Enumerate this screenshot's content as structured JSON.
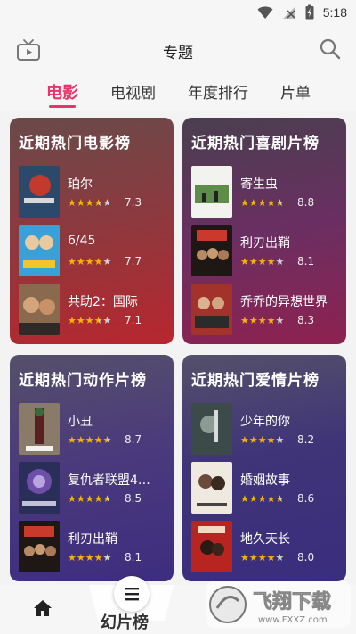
{
  "status_bar": {
    "time": "5:18",
    "icons": [
      "wifi-icon",
      "no-signal-icon",
      "battery-charging-icon"
    ]
  },
  "app_bar": {
    "title": "专题",
    "left_icon": "tv-icon",
    "right_icon": "search-icon"
  },
  "tabs": [
    {
      "label": "电影",
      "active": true
    },
    {
      "label": "电视剧",
      "active": false
    },
    {
      "label": "年度排行",
      "active": false
    },
    {
      "label": "片单",
      "active": false
    }
  ],
  "colors": {
    "accent": "#e8336b",
    "star": "#f5b301"
  },
  "cards": [
    {
      "title": "近期热门电影榜",
      "items": [
        {
          "name": "珀尔",
          "rating": 3.5,
          "score": "7.3"
        },
        {
          "name": "6/45",
          "rating": 4.0,
          "score": "7.7"
        },
        {
          "name": "共助2：国际",
          "rating": 3.5,
          "score": "7.1"
        }
      ]
    },
    {
      "title": "近期热门喜剧片榜",
      "items": [
        {
          "name": "寄生虫",
          "rating": 4.5,
          "score": "8.8"
        },
        {
          "name": "利刃出鞘",
          "rating": 4.0,
          "score": "8.1"
        },
        {
          "name": "乔乔的异想世界",
          "rating": 4.0,
          "score": "8.3"
        }
      ]
    },
    {
      "title": "近期热门动作片榜",
      "items": [
        {
          "name": "小丑",
          "rating": 4.5,
          "score": "8.7"
        },
        {
          "name": "复仇者联盟4…",
          "rating": 4.5,
          "score": "8.5"
        },
        {
          "name": "利刃出鞘",
          "rating": 4.0,
          "score": "8.1"
        }
      ]
    },
    {
      "title": "近期热门爱情片榜",
      "items": [
        {
          "name": "少年的你",
          "rating": 4.0,
          "score": "8.2"
        },
        {
          "name": "婚姻故事",
          "rating": 4.5,
          "score": "8.6"
        },
        {
          "name": "地久天长",
          "rating": 4.0,
          "score": "8.0"
        }
      ]
    }
  ],
  "bottom_nav": {
    "partial_label": "幻片榜",
    "icons": [
      "home-icon",
      "list-icon"
    ]
  },
  "watermark": {
    "text": "飞翔下载",
    "url_text": "www.FXXZ.com"
  }
}
